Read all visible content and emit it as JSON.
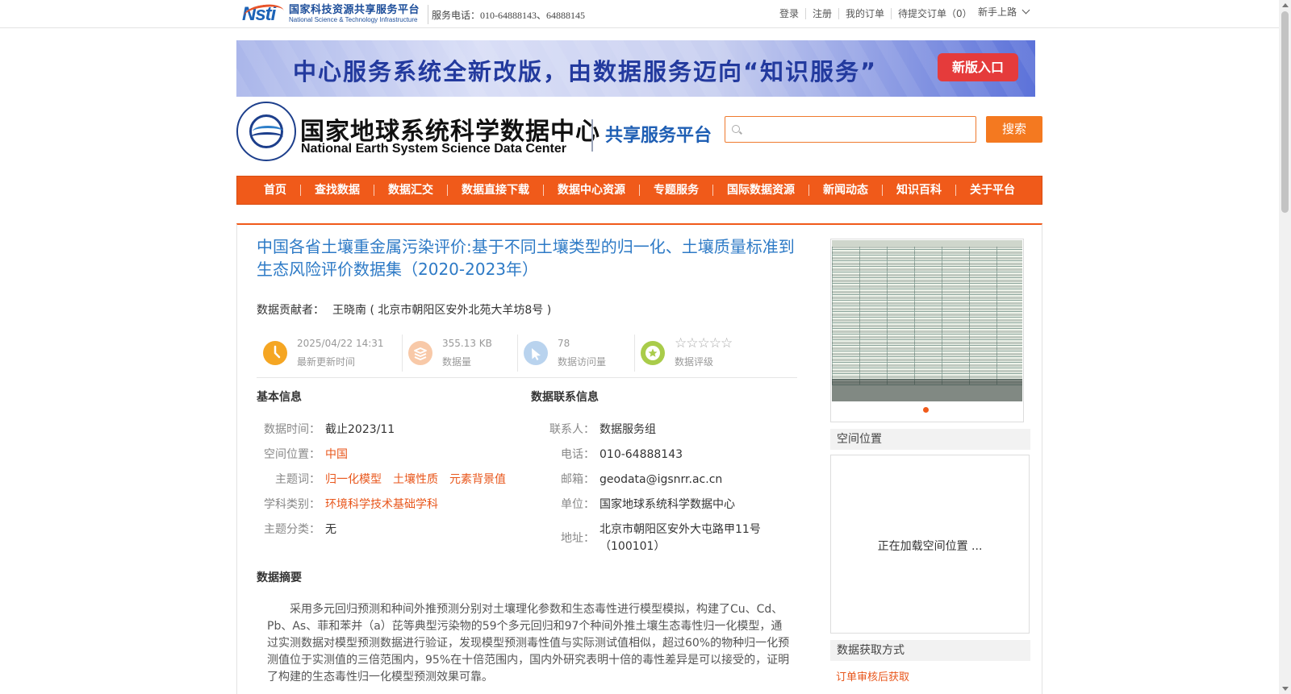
{
  "topbar": {
    "logo_cn": "国家科技资源共享服务平台",
    "logo_en": "National Science & Technology Infrastructure",
    "hotline": "服务电话：010-64888143、64888145",
    "links": [
      "登录",
      "注册",
      "我的订单",
      "待提交订单（0）"
    ],
    "guide": "新手上路"
  },
  "banner": {
    "text": "中心服务系统全新改版，由数据服务迈向“知识服务”",
    "button": "新版入口"
  },
  "header": {
    "center_cn": "国家地球系统科学数据中心",
    "center_en": "National Earth System Science Data Center",
    "platform": "共享服务平台",
    "search_placeholder": "",
    "search_button": "搜索"
  },
  "nav": [
    "首页",
    "查找数据",
    "数据汇交",
    "数据直接下载",
    "数据中心资源",
    "专题服务",
    "国际数据资源",
    "新闻动态",
    "知识百科",
    "关于平台"
  ],
  "dataset": {
    "title": "中国各省土壤重金属污染评价:基于不同土壤类型的归一化、土壤质量标准到生态风险评价数据集（2020-2023年）",
    "contributor_label": "数据贡献者：",
    "contributor": "王晓南 ( 北京市朝阳区安外北苑大羊坊8号 )",
    "stats": [
      {
        "value": "2025/04/22 14:31",
        "label": "最新更新时间",
        "icon": "clock-icon",
        "color": "#f5a623"
      },
      {
        "value": "355.13 KB",
        "label": "数据量",
        "icon": "layers-icon",
        "color": "#f8c9a8"
      },
      {
        "value": "78",
        "label": "数据访问量",
        "icon": "visits-icon",
        "color": "#b9d3ee"
      },
      {
        "value": "☆☆☆☆☆",
        "label": "数据评级",
        "icon": "star-icon",
        "color": "#a9cc4a",
        "rating": 0
      }
    ]
  },
  "basic_info": {
    "title": "基本信息",
    "rows": [
      {
        "key": "数据时间：",
        "value": "截止2023/11"
      },
      {
        "key": "空间位置：",
        "links": [
          "中国"
        ]
      },
      {
        "key": "主题词：",
        "links": [
          "归一化模型",
          "土壤性质",
          "元素背景值"
        ]
      },
      {
        "key": "学科类别：",
        "links": [
          "环境科学技术基础学科"
        ]
      },
      {
        "key": "主题分类：",
        "value": "无"
      }
    ]
  },
  "contact_info": {
    "title": "数据联系信息",
    "rows": [
      {
        "key": "联系人：",
        "value": "数据服务组"
      },
      {
        "key": "电话：",
        "value": "010-64888143"
      },
      {
        "key": "邮箱：",
        "value": "geodata@igsnrr.ac.cn"
      },
      {
        "key": "单位：",
        "value": "国家地球系统科学数据中心"
      },
      {
        "key": "地址：",
        "value_line1": "北京市朝阳区安外大屯路甲11号",
        "value_line2": "（100101）"
      }
    ]
  },
  "abstract": {
    "title": "数据摘要",
    "text": "采用多元回归预测和种间外推预测分别对土壤理化参数和生态毒性进行模型模拟，构建了Cu、Cd、Pb、As、菲和苯并（a）芘等典型污染物的59个多元回归和97个种间外推土壤生态毒性归一化模型，通过实测数据对模型预测数据进行验证，发现模型预测毒性值与实际测试值相似，超过60%的物种归一化预测值位于实测值的三倍范围内，95%在十倍范围内，国内外研究表明十倍的毒性差异是可以接受的，证明了构建的生态毒性归一化模型预测效果可靠。"
  },
  "sidebar": {
    "spatial_title": "空间位置",
    "spatial_loading": "正在加载空间位置 ...",
    "access_title": "数据获取方式",
    "access_link": "订单审核后获取"
  },
  "colors": {
    "accent": "#f05a1a",
    "title_blue": "#2d7ac6",
    "link_orange": "#e8561b"
  }
}
